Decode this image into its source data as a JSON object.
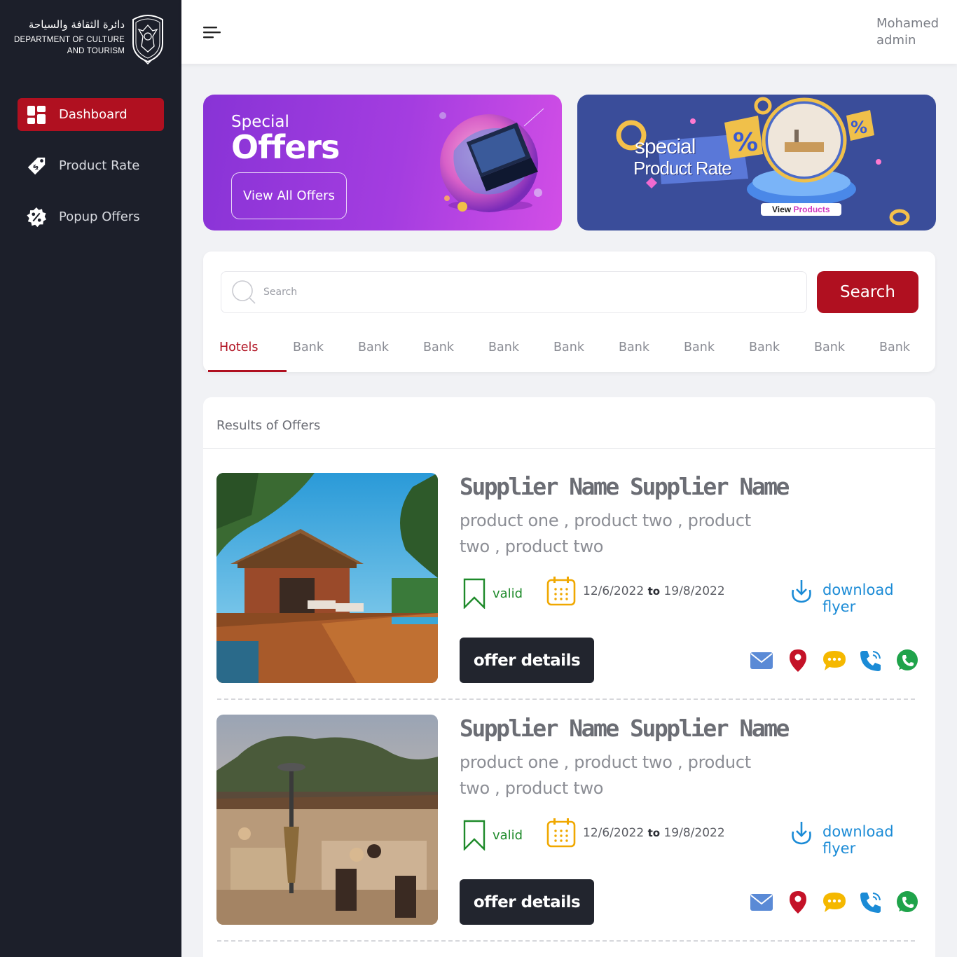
{
  "logo": {
    "arabic": "دائرة الثقافة والسياحة",
    "english_line1": "DEPARTMENT OF CULTURE",
    "english_line2": "AND TOURISM"
  },
  "sidebar": {
    "items": [
      {
        "label": "Dashboard",
        "icon": "dashboard-icon",
        "active": true
      },
      {
        "label": "Product Rate",
        "icon": "price-tag-icon",
        "active": false
      },
      {
        "label": "Popup Offers",
        "icon": "discount-badge-icon",
        "active": false
      }
    ]
  },
  "header": {
    "user_name": "Mohamed",
    "user_role": "admin"
  },
  "banners": {
    "offers": {
      "line1": "Special",
      "line2": "Offers",
      "button": "View All Offers"
    },
    "rate": {
      "line1": "special",
      "line2": "Product Rate",
      "button_part1": "View",
      "button_part2": "Products"
    }
  },
  "search": {
    "placeholder": "Search",
    "button": "Search"
  },
  "tabs": [
    "Hotels",
    "Bank",
    "Bank",
    "Bank",
    "Bank",
    "Bank",
    "Bank",
    "Bank",
    "Bank",
    "Bank",
    "Bank"
  ],
  "results": {
    "title": "Results of Offers",
    "offers": [
      {
        "supplier": "Supplier Name Supplier Name",
        "products": "product one , product two ,  product two , product two",
        "status": "valid",
        "date_from": "12/6/2022",
        "date_sep": "to",
        "date_to": "19/8/2022",
        "download": "download flyer",
        "details": "offer details"
      },
      {
        "supplier": "Supplier Name Supplier Name",
        "products": "product one , product two ,  product two , product two",
        "status": "valid",
        "date_from": "12/6/2022",
        "date_sep": "to",
        "date_to": "19/8/2022",
        "download": "download flyer",
        "details": "offer details"
      }
    ]
  },
  "colors": {
    "sidebar_bg": "#1c1f2a",
    "accent_red": "#b01020",
    "valid_green": "#1e8a2a",
    "download_blue": "#1b8bd6",
    "calendar_orange": "#f0a800"
  }
}
